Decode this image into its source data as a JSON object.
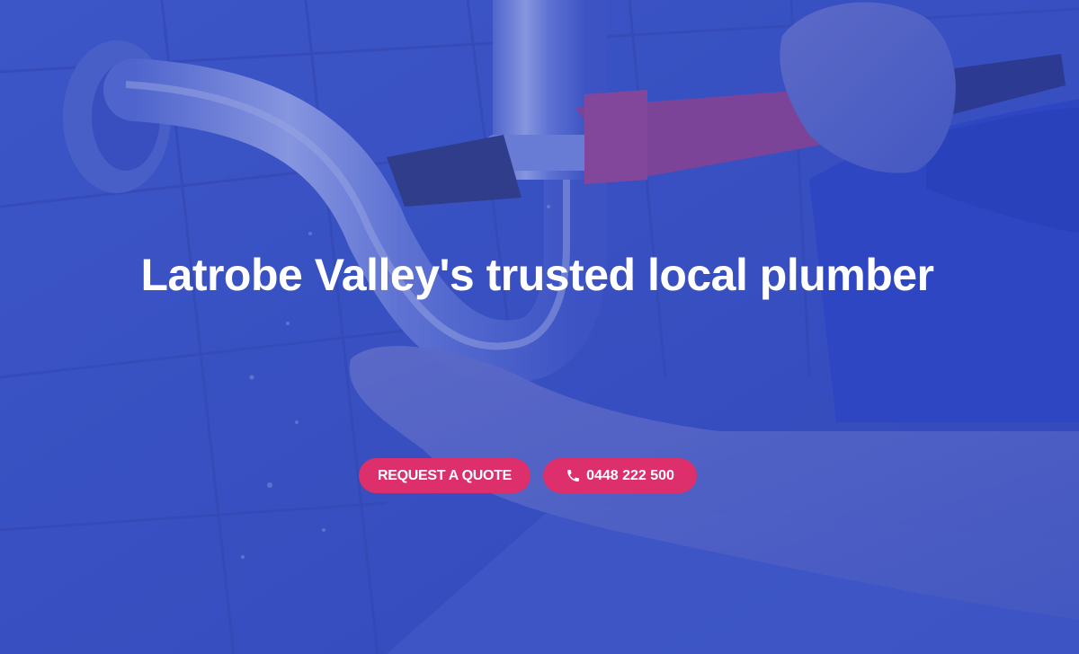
{
  "hero": {
    "headline": "Latrobe Valley's trusted local plumber",
    "background_image": "plumber-repairing-sink-pipe-with-wrench",
    "overlay_color": "#3c54c4",
    "buttons": {
      "quote_label": "REQUEST A QUOTE",
      "phone_label": "0448 222 500",
      "phone_icon": "phone-icon",
      "color": "#dc2f6c"
    }
  }
}
